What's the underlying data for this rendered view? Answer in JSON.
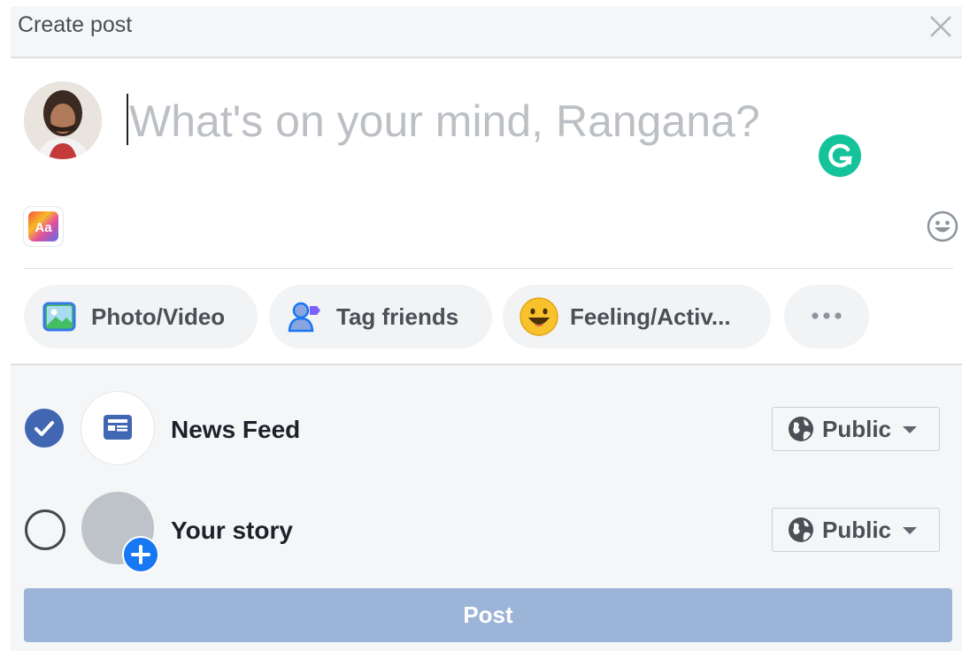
{
  "header": {
    "title": "Create post",
    "close_icon": "close-icon"
  },
  "composer": {
    "placeholder": "What's on your mind, Rangana?",
    "avatar": "user-avatar",
    "grammarly_icon": "grammarly-icon",
    "text_style_icon": "text-style-icon",
    "emoji_icon": "emoji-icon"
  },
  "actions": [
    {
      "label": "Photo/Video",
      "icon": "photo-icon"
    },
    {
      "label": "Tag friends",
      "icon": "tag-friends-icon"
    },
    {
      "label": "Feeling/Activ...",
      "icon": "feeling-icon"
    },
    {
      "label": "",
      "icon": "more-icon"
    }
  ],
  "audience": {
    "news_feed": {
      "label": "News Feed",
      "checked": true,
      "privacy": "Public"
    },
    "your_story": {
      "label": "Your story",
      "checked": false,
      "privacy": "Public"
    }
  },
  "post_button": {
    "label": "Post"
  },
  "colors": {
    "accent": "#4267b2",
    "post_disabled": "#9cb4d8",
    "grammarly": "#15c39a",
    "chip_bg": "#f2f3f5",
    "section_bg": "#f5f6f7"
  }
}
